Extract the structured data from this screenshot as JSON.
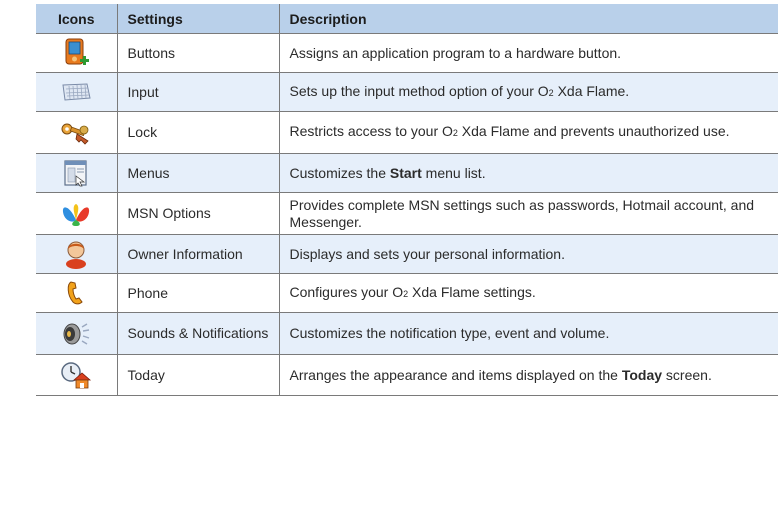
{
  "table": {
    "headers": {
      "icons": "Icons",
      "settings": "Settings",
      "description": "Description"
    },
    "rows": [
      {
        "icon": "buttons-device-icon",
        "setting": "Buttons",
        "desc": [
          "Assigns an application program to a hardware button."
        ]
      },
      {
        "icon": "keyboard-icon",
        "setting": "Input",
        "desc": [
          "Sets up the input method option of your O",
          "2",
          " Xda Flame."
        ]
      },
      {
        "icon": "keys-lock-icon",
        "setting": "Lock",
        "desc": [
          "Restricts access to your O",
          "2",
          " Xda Flame and prevents unauthorized use."
        ]
      },
      {
        "icon": "menu-window-icon",
        "setting": "Menus",
        "desc": [
          "Customizes the ",
          "Start",
          " menu list."
        ]
      },
      {
        "icon": "msn-butterfly-icon",
        "setting": "MSN Options",
        "desc": [
          "Provides complete MSN settings such as passwords, Hotmail account, and Messenger."
        ]
      },
      {
        "icon": "owner-person-icon",
        "setting": "Owner Information",
        "desc": [
          "Displays and sets your personal information."
        ]
      },
      {
        "icon": "phone-handset-icon",
        "setting": "Phone",
        "desc": [
          "Configures your O",
          "2",
          " Xda Flame settings."
        ]
      },
      {
        "icon": "speaker-sound-icon",
        "setting": "Sounds & Notifications",
        "desc": [
          "Customizes the notification type, event and volume."
        ]
      },
      {
        "icon": "today-clock-home-icon",
        "setting": "Today",
        "desc": [
          "Arranges the appearance and items displayed on the ",
          "Today",
          " screen."
        ]
      }
    ]
  }
}
